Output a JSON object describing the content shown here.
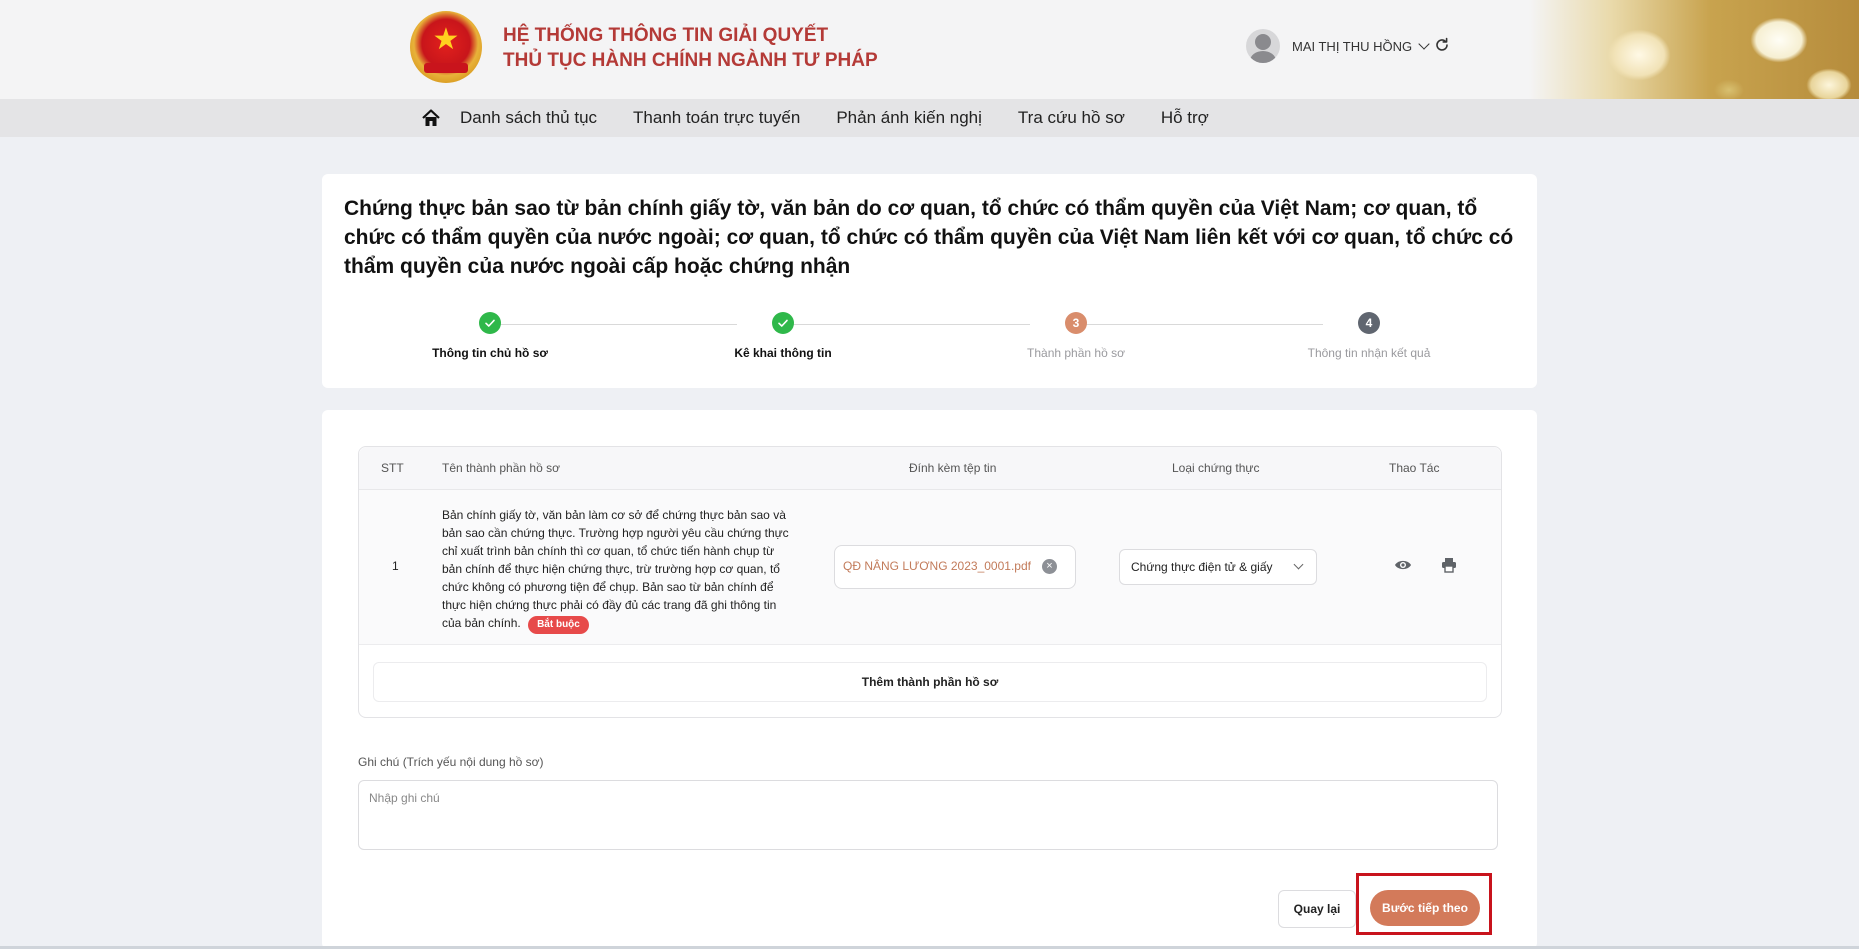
{
  "header": {
    "title_line1": "HỆ THỐNG THÔNG TIN GIẢI QUYẾT",
    "title_line2": "THỦ TỤC HÀNH CHÍNH NGÀNH TƯ PHÁP",
    "user_name": "MAI THỊ THU HỒNG"
  },
  "nav": {
    "items": [
      "Danh sách thủ tục",
      "Thanh toán trực tuyến",
      "Phản ánh kiến nghị",
      "Tra cứu hồ sơ",
      "Hỗ trợ"
    ]
  },
  "procedure": {
    "title": "Chứng thực bản sao từ bản chính giấy tờ, văn bản do cơ quan, tổ chức có thẩm quyền của Việt Nam; cơ quan, tổ chức có thẩm quyền của nước ngoài; cơ quan, tổ chức có thẩm quyền của Việt Nam liên kết với cơ quan, tổ chức có thẩm quyền của nước ngoài cấp hoặc chứng nhận"
  },
  "steps": [
    {
      "number": "1",
      "label": "Thông tin chủ hồ sơ",
      "status": "done"
    },
    {
      "number": "2",
      "label": "Kê khai thông tin",
      "status": "done"
    },
    {
      "number": "3",
      "label": "Thành phần hồ sơ",
      "status": "current"
    },
    {
      "number": "4",
      "label": "Thông tin nhận kết quả",
      "status": "pending"
    }
  ],
  "table": {
    "headers": {
      "stt": "STT",
      "name": "Tên thành phần hồ sơ",
      "attach": "Đính kèm tệp tin",
      "type": "Loại chứng thực",
      "actions": "Thao Tác"
    },
    "rows": [
      {
        "stt": "1",
        "name": "Bản chính giấy tờ, văn bản làm cơ sở để chứng thực bản sao và bản sao cần chứng thực. Trường hợp người yêu cầu chứng thực chỉ xuất trình bản chính thì cơ quan, tổ chức tiến hành chụp từ bản chính để thực hiện chứng thực, trừ trường hợp cơ quan, tổ chức không có phương tiện để chụp. Bản sao từ bản chính để thực hiện chứng thực phải có đầy đủ các trang đã ghi thông tin của bản chính.",
        "badge": "Bắt buộc",
        "file": "QĐ NÂNG LƯƠNG 2023_0001.pdf",
        "type": "Chứng thực điện tử & giấy"
      }
    ],
    "add_label": "Thêm thành phần hồ sơ"
  },
  "note": {
    "label": "Ghi chú (Trích yếu nội dung hồ sơ)",
    "placeholder": "Nhập ghi chú",
    "value": ""
  },
  "buttons": {
    "back": "Quay lại",
    "next": "Bước tiếp theo"
  },
  "colors": {
    "brand_red": "#b43a37",
    "step_done": "#2fb84a",
    "step_current": "#d98d6c",
    "step_pending": "#606670",
    "accent": "#d37a5a",
    "highlight_box": "#c8131c"
  },
  "icons": [
    "national-emblem-icon",
    "user-avatar-icon",
    "chevron-down-icon",
    "refresh-icon",
    "home-icon",
    "check-icon",
    "close-icon",
    "eye-icon",
    "print-icon"
  ]
}
